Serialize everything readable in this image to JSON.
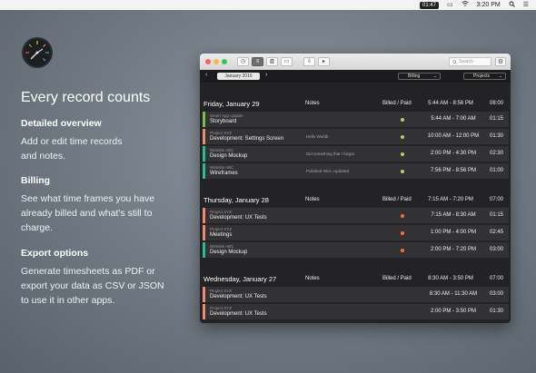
{
  "menubar": {
    "timer": "01:47",
    "battery_icon": "battery-icon",
    "wifi_icon": "wifi-icon",
    "time": "3:20 PM",
    "search_icon": "search-icon",
    "menu_icon": "list-icon"
  },
  "marketing": {
    "headline": "Every record counts",
    "features": [
      {
        "title": "Detailed overview",
        "body": "Add or edit time records and notes."
      },
      {
        "title": "Billing",
        "body": "See what time frames you have already billed and what's still to charge."
      },
      {
        "title": "Export options",
        "body": "Generate timesheets as PDF or export your data as CSV or JSON to use it in other apps."
      }
    ]
  },
  "window": {
    "search_placeholder": "Search",
    "month": "January 2016",
    "filter_billing": "Billing",
    "filter_projects": "Projects",
    "columns": {
      "notes": "Notes",
      "billed": "Billed / Paid"
    },
    "colors": {
      "green": "#7bc043",
      "salmon": "#ef8a6f",
      "teal": "#1fc28b",
      "dot_yellow": "#c9c46a",
      "dot_orange": "#ff6b2c"
    },
    "days": [
      {
        "date": "Friday, January 29",
        "range": "5:44 AM - 8:56 PM",
        "total": "08:00",
        "entries": [
          {
            "project": "Smart App Update",
            "task": "Storyboard",
            "note": "",
            "color": "#7bc043",
            "dot": "#c9c46a",
            "range": "5:44 AM - 7:00 AM",
            "duration": "01:15"
          },
          {
            "project": "Project XYZ",
            "task": "Development: Settings Screen",
            "note": "Hello World!",
            "color": "#ef8a6f",
            "dot": "#c9c46a",
            "range": "10:00 AM - 12:00 PM",
            "duration": "01:30"
          },
          {
            "project": "Website ABC",
            "task": "Design Mockup",
            "note": "Did something that I forgot",
            "color": "#1fc28b",
            "dot": "#c9c46a",
            "range": "2:00 PM - 4:30 PM",
            "duration": "02:30"
          },
          {
            "project": "Website ABC",
            "task": "Wireframes",
            "note": "Polished Intro, Updated",
            "color": "#1fc28b",
            "dot": "#c9c46a",
            "range": "7:56 PM - 8:56 PM",
            "duration": "01:00"
          }
        ]
      },
      {
        "date": "Thursday, January 28",
        "range": "7:15 AM - 7:20 PM",
        "total": "07:00",
        "entries": [
          {
            "project": "Project XYZ",
            "task": "Development: UX Tests",
            "note": "",
            "color": "#ef8a6f",
            "dot": "#ff6b2c",
            "range": "7:15 AM - 8:30 AM",
            "duration": "01:15"
          },
          {
            "project": "Project XYZ",
            "task": "Meetings",
            "note": "",
            "color": "#ef8a6f",
            "dot": "#ff6b2c",
            "range": "1:00 PM - 4:00 PM",
            "duration": "02:45"
          },
          {
            "project": "Website ABC",
            "task": "Design Mockup",
            "note": "",
            "color": "#1fc28b",
            "dot": "#ff6b2c",
            "range": "2:00 PM - 7:20 PM",
            "duration": "03:00"
          }
        ]
      },
      {
        "date": "Wednesday, January 27",
        "range": "8:30 AM - 3:50 PM",
        "total": "07:00",
        "entries": [
          {
            "project": "Project XYZ",
            "task": "Development: UX Tests",
            "note": "",
            "color": "#ef8a6f",
            "dot": "",
            "range": "8:30 AM - 11:30 AM",
            "duration": "03:00"
          },
          {
            "project": "Project XYZ",
            "task": "Development: UX Tests",
            "note": "",
            "color": "#ef8a6f",
            "dot": "",
            "range": "2:00 PM - 3:50 PM",
            "duration": "01:30"
          }
        ]
      }
    ]
  }
}
